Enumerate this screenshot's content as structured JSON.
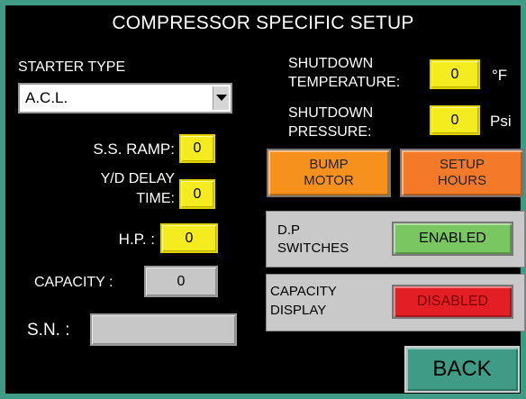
{
  "title": "COMPRESSOR SPECIFIC SETUP",
  "starter_type": {
    "label": "STARTER TYPE",
    "selected": "A.C.L.",
    "arrow_icon": "chevron-down-icon"
  },
  "ss_ramp": {
    "label": "S.S. RAMP:",
    "value": "0"
  },
  "yd_delay": {
    "label_line1": "Y/D  DELAY",
    "label_line2": "TIME:",
    "value": "0"
  },
  "hp": {
    "label": "H.P. :",
    "value": "0"
  },
  "capacity": {
    "label": "CAPACITY :",
    "value": "0"
  },
  "sn": {
    "label": "S.N. :",
    "value": ""
  },
  "shutdown_temperature": {
    "label_line1": "SHUTDOWN",
    "label_line2": "TEMPERATURE:",
    "value": "0",
    "unit": "°F"
  },
  "shutdown_pressure": {
    "label_line1": "SHUTDOWN",
    "label_line2": "PRESSURE:",
    "value": "0",
    "unit": "Psi"
  },
  "bump_motor": {
    "line1": "BUMP",
    "line2": "MOTOR"
  },
  "setup_hours": {
    "line1": "SETUP",
    "line2": "HOURS"
  },
  "dp_switches": {
    "line1": "D.P",
    "line2": "SWITCHES",
    "status": "ENABLED"
  },
  "capacity_display": {
    "line1": "CAPACITY",
    "line2": "DISPLAY",
    "status": "DISABLED"
  },
  "back_button": "BACK",
  "colors": {
    "frame": "#3f9b86",
    "yellow_field": "#f4ec1e",
    "gray_field": "#c7c7c7",
    "orange_button": "#f7911e",
    "orange_red_button": "#f47a2a",
    "enabled_green": "#79c760",
    "disabled_red": "#e31e24"
  }
}
